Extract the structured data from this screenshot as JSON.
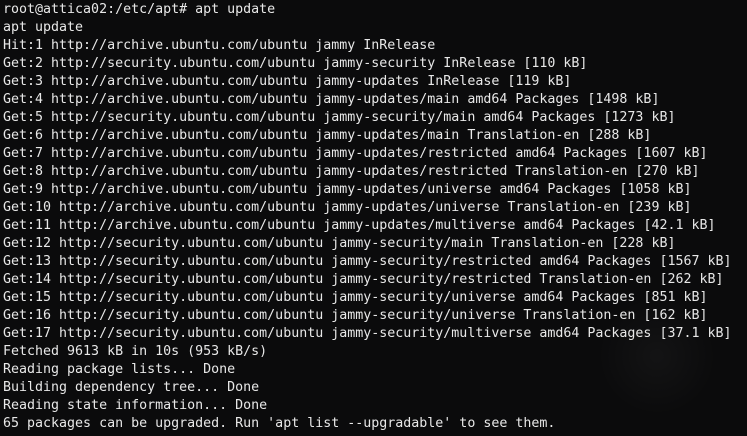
{
  "terminal": {
    "prompt": "root@attica02:/etc/apt# apt update",
    "lines": [
      "apt update",
      "Hit:1 http://archive.ubuntu.com/ubuntu jammy InRelease",
      "Get:2 http://security.ubuntu.com/ubuntu jammy-security InRelease [110 kB]",
      "Get:3 http://archive.ubuntu.com/ubuntu jammy-updates InRelease [119 kB]",
      "Get:4 http://archive.ubuntu.com/ubuntu jammy-updates/main amd64 Packages [1498 kB]",
      "Get:5 http://security.ubuntu.com/ubuntu jammy-security/main amd64 Packages [1273 kB]",
      "Get:6 http://archive.ubuntu.com/ubuntu jammy-updates/main Translation-en [288 kB]",
      "Get:7 http://archive.ubuntu.com/ubuntu jammy-updates/restricted amd64 Packages [1607 kB]",
      "Get:8 http://archive.ubuntu.com/ubuntu jammy-updates/restricted Translation-en [270 kB]",
      "Get:9 http://archive.ubuntu.com/ubuntu jammy-updates/universe amd64 Packages [1058 kB]",
      "Get:10 http://archive.ubuntu.com/ubuntu jammy-updates/universe Translation-en [239 kB]",
      "Get:11 http://archive.ubuntu.com/ubuntu jammy-updates/multiverse amd64 Packages [42.1 kB]",
      "Get:12 http://security.ubuntu.com/ubuntu jammy-security/main Translation-en [228 kB]",
      "Get:13 http://security.ubuntu.com/ubuntu jammy-security/restricted amd64 Packages [1567 kB]",
      "Get:14 http://security.ubuntu.com/ubuntu jammy-security/restricted Translation-en [262 kB]",
      "Get:15 http://security.ubuntu.com/ubuntu jammy-security/universe amd64 Packages [851 kB]",
      "Get:16 http://security.ubuntu.com/ubuntu jammy-security/universe Translation-en [162 kB]",
      "Get:17 http://security.ubuntu.com/ubuntu jammy-security/multiverse amd64 Packages [37.1 kB]",
      "Fetched 9613 kB in 10s (953 kB/s)",
      "Reading package lists... Done",
      "Building dependency tree... Done",
      "Reading state information... Done",
      "65 packages can be upgraded. Run 'apt list --upgradable' to see them."
    ]
  },
  "colors": {
    "background": "#0b0b0c",
    "text": "#e8e8e8"
  }
}
